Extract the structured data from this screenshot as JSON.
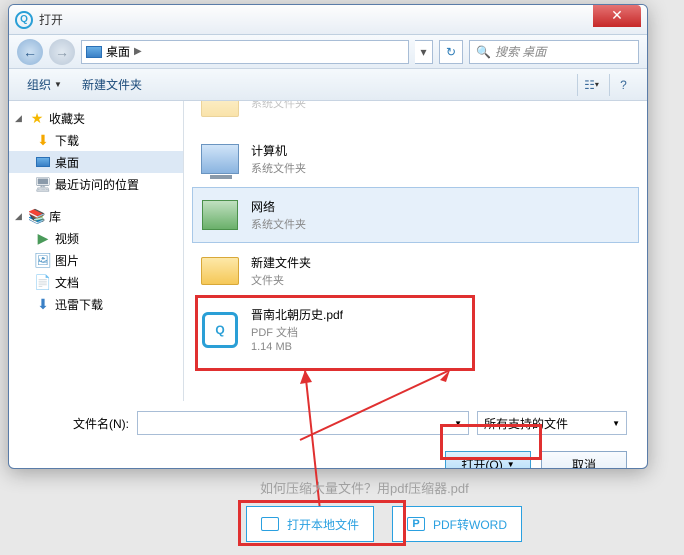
{
  "title": "打开",
  "location": "桌面",
  "search_placeholder": "搜索 桌面",
  "toolbar": {
    "organize": "组织",
    "newfolder": "新建文件夹"
  },
  "tree": {
    "favorites": "收藏夹",
    "downloads": "下载",
    "desktop": "桌面",
    "recent": "最近访问的位置",
    "libraries": "库",
    "videos": "视频",
    "pictures": "图片",
    "documents": "文档",
    "xunlei": "迅雷下载"
  },
  "items": [
    {
      "name": "系统文件夹",
      "sub": ""
    },
    {
      "name": "计算机",
      "sub": "系统文件夹"
    },
    {
      "name": "网络",
      "sub": "系统文件夹"
    },
    {
      "name": "新建文件夹",
      "sub": "文件夹"
    },
    {
      "name": "晋南北朝历史.pdf",
      "sub": "PDF 文档",
      "size": "1.14 MB"
    }
  ],
  "filename_label": "文件名(N):",
  "filter": "所有支持的文件",
  "open_btn": "打开(O)",
  "cancel_btn": "取消",
  "bg_text": "如何压缩大量文件？用pdf压缩器.pdf",
  "bottom": {
    "open_local": "打开本地文件",
    "pdf2word": "PDF转WORD"
  }
}
